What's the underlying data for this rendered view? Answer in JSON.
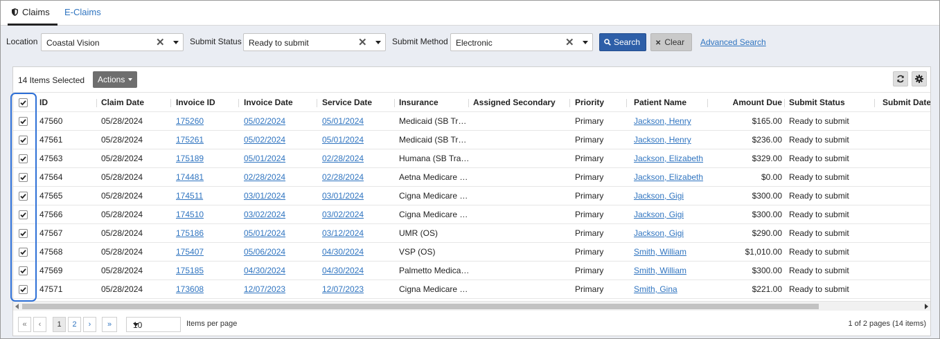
{
  "tabs": [
    {
      "label": "Claims",
      "active": true,
      "icon": "shield-icon"
    },
    {
      "label": "E-Claims",
      "active": false
    }
  ],
  "filters": {
    "location_label": "Location",
    "location_value": "Coastal Vision",
    "submit_status_label": "Submit Status",
    "submit_status_value": "Ready to submit",
    "submit_method_label": "Submit Method",
    "submit_method_value": "Electronic",
    "search_label": "Search",
    "clear_label": "Clear",
    "advanced_label": "Advanced Search"
  },
  "grid": {
    "selected_text": "14 Items Selected",
    "actions_label": "Actions",
    "columns": [
      "ID",
      "Claim Date",
      "Invoice ID",
      "Invoice Date",
      "Service Date",
      "Insurance",
      "Assigned Secondary",
      "Priority",
      "Patient Name",
      "Amount Due",
      "Submit Status",
      "Submit Date"
    ],
    "rows": [
      {
        "id": "47560",
        "claim_date": "05/28/2024",
        "invoice_id": "175260",
        "invoice_date": "05/02/2024",
        "service_date": "05/01/2024",
        "insurance": "Medicaid (SB Tr…",
        "secondary": "",
        "priority": "Primary",
        "patient": "Jackson, Henry",
        "amount": "$165.00",
        "status": "Ready to submit",
        "submit_date": ""
      },
      {
        "id": "47561",
        "claim_date": "05/28/2024",
        "invoice_id": "175261",
        "invoice_date": "05/02/2024",
        "service_date": "05/01/2024",
        "insurance": "Medicaid (SB Tr…",
        "secondary": "",
        "priority": "Primary",
        "patient": "Jackson, Henry",
        "amount": "$236.00",
        "status": "Ready to submit",
        "submit_date": ""
      },
      {
        "id": "47563",
        "claim_date": "05/28/2024",
        "invoice_id": "175189",
        "invoice_date": "05/01/2024",
        "service_date": "02/28/2024",
        "insurance": "Humana (SB Tra…",
        "secondary": "",
        "priority": "Primary",
        "patient": "Jackson, Elizabeth",
        "amount": "$329.00",
        "status": "Ready to submit",
        "submit_date": ""
      },
      {
        "id": "47564",
        "claim_date": "05/28/2024",
        "invoice_id": "174481",
        "invoice_date": "02/28/2024",
        "service_date": "02/28/2024",
        "insurance": "Aetna Medicare …",
        "secondary": "",
        "priority": "Primary",
        "patient": "Jackson, Elizabeth",
        "amount": "$0.00",
        "status": "Ready to submit",
        "submit_date": ""
      },
      {
        "id": "47565",
        "claim_date": "05/28/2024",
        "invoice_id": "174511",
        "invoice_date": "03/01/2024",
        "service_date": "03/01/2024",
        "insurance": "Cigna Medicare …",
        "secondary": "",
        "priority": "Primary",
        "patient": "Jackson, Gigi",
        "amount": "$300.00",
        "status": "Ready to submit",
        "submit_date": ""
      },
      {
        "id": "47566",
        "claim_date": "05/28/2024",
        "invoice_id": "174510",
        "invoice_date": "03/02/2024",
        "service_date": "03/02/2024",
        "insurance": "Cigna Medicare …",
        "secondary": "",
        "priority": "Primary",
        "patient": "Jackson, Gigi",
        "amount": "$300.00",
        "status": "Ready to submit",
        "submit_date": ""
      },
      {
        "id": "47567",
        "claim_date": "05/28/2024",
        "invoice_id": "175186",
        "invoice_date": "05/01/2024",
        "service_date": "03/12/2024",
        "insurance": "UMR (OS)",
        "secondary": "",
        "priority": "Primary",
        "patient": "Jackson, Gigi",
        "amount": "$290.00",
        "status": "Ready to submit",
        "submit_date": ""
      },
      {
        "id": "47568",
        "claim_date": "05/28/2024",
        "invoice_id": "175407",
        "invoice_date": "05/06/2024",
        "service_date": "04/30/2024",
        "insurance": "VSP (OS)",
        "secondary": "",
        "priority": "Primary",
        "patient": "Smith, William",
        "amount": "$1,010.00",
        "status": "Ready to submit",
        "submit_date": ""
      },
      {
        "id": "47569",
        "claim_date": "05/28/2024",
        "invoice_id": "175185",
        "invoice_date": "04/30/2024",
        "service_date": "04/30/2024",
        "insurance": "Palmetto Medica…",
        "secondary": "",
        "priority": "Primary",
        "patient": "Smith, William",
        "amount": "$300.00",
        "status": "Ready to submit",
        "submit_date": ""
      },
      {
        "id": "47571",
        "claim_date": "05/28/2024",
        "invoice_id": "173608",
        "invoice_date": "12/07/2023",
        "service_date": "12/07/2023",
        "insurance": "Cigna Medicare …",
        "secondary": "",
        "priority": "Primary",
        "patient": "Smith, Gina",
        "amount": "$221.00",
        "status": "Ready to submit",
        "submit_date": ""
      }
    ]
  },
  "pager": {
    "first": "«",
    "prev": "‹",
    "pages": [
      "1",
      "2"
    ],
    "current_page": "1",
    "next": "›",
    "last": "»",
    "per_page_value": "10",
    "per_page_label": "Items per page",
    "info": "1 of 2 pages (14 items)"
  },
  "colors": {
    "accent": "#2e5fa8",
    "link": "#2f74c0",
    "highlight": "#2d6fd6",
    "filter_bg": "#eaedf3"
  }
}
